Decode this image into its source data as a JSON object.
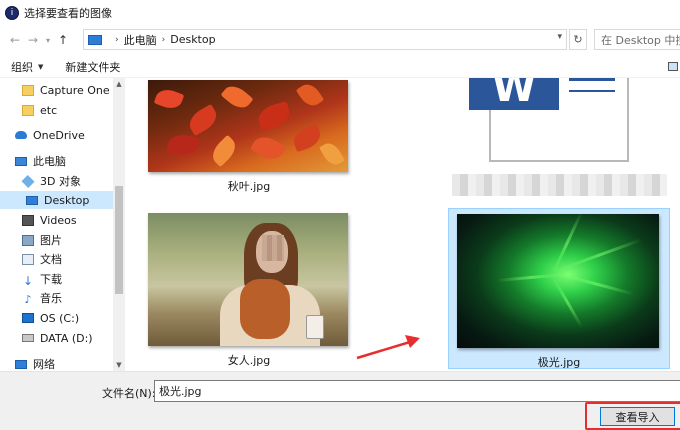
{
  "window": {
    "title": "选择要查看的图像",
    "icon": "app-icon"
  },
  "nav": {
    "back_icon": "back-arrow-icon",
    "forward_icon": "forward-arrow-icon",
    "recent_icon": "chevron-down-icon",
    "up_icon": "up-arrow-icon",
    "breadcrumb": [
      "此电脑",
      "Desktop"
    ],
    "refresh_glyph": "↻",
    "search_placeholder": "在 Desktop 中搜"
  },
  "toolbar": {
    "organize_label": "组织",
    "new_folder_label": "新建文件夹"
  },
  "sidebar": {
    "items": [
      {
        "label": "Capture One C",
        "icon": "folder-icon"
      },
      {
        "label": "etc",
        "icon": "folder-icon"
      },
      {
        "label": "OneDrive",
        "icon": "cloud-icon"
      },
      {
        "label": "此电脑",
        "icon": "pc-icon"
      },
      {
        "label": "3D 对象",
        "icon": "3d-objects-icon"
      },
      {
        "label": "Desktop",
        "icon": "desktop-icon",
        "selected": true
      },
      {
        "label": "Videos",
        "icon": "video-icon"
      },
      {
        "label": "图片",
        "icon": "picture-icon"
      },
      {
        "label": "文档",
        "icon": "document-icon"
      },
      {
        "label": "下载",
        "icon": "download-icon"
      },
      {
        "label": "音乐",
        "icon": "music-icon"
      },
      {
        "label": "OS (C:)",
        "icon": "os-drive-icon"
      },
      {
        "label": "DATA (D:)",
        "icon": "drive-icon"
      },
      {
        "label": "网络",
        "icon": "network-icon"
      }
    ]
  },
  "files": [
    {
      "name": "秋叶.jpg",
      "thumbnail": "autumn-leaves-photo"
    },
    {
      "name": "",
      "thumbnail": "word-document-icon"
    },
    {
      "name": "女人.jpg",
      "thumbnail": "woman-portrait-photo"
    },
    {
      "name": "极光.jpg",
      "thumbnail": "aurora-photo",
      "selected": true
    }
  ],
  "footer": {
    "filename_label": "文件名(N):",
    "filename_value": "极光.jpg",
    "open_button_label": "查看导入"
  },
  "colors": {
    "selection": "#cce8ff",
    "selection_border": "#99d1ff",
    "annotation_red": "#e62e2e",
    "accent_blue": "#0078d7"
  }
}
